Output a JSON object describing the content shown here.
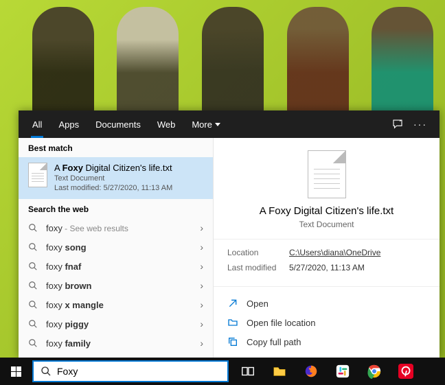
{
  "tabs": {
    "all": "All",
    "apps": "Apps",
    "documents": "Documents",
    "web": "Web",
    "more": "More"
  },
  "sections": {
    "best_match": "Best match",
    "search_web": "Search the web"
  },
  "best_match": {
    "title_prefix": "A ",
    "title_bold": "Foxy",
    "title_suffix": " Digital Citizen's life.txt",
    "type": "Text Document",
    "modified": "Last modified: 5/27/2020, 11:13 AM"
  },
  "web_results": [
    {
      "prefix": "foxy",
      "bold": "",
      "hint": " - See web results"
    },
    {
      "prefix": "foxy ",
      "bold": "song",
      "hint": ""
    },
    {
      "prefix": "foxy ",
      "bold": "fnaf",
      "hint": ""
    },
    {
      "prefix": "foxy ",
      "bold": "brown",
      "hint": ""
    },
    {
      "prefix": "foxy ",
      "bold": "x mangle",
      "hint": ""
    },
    {
      "prefix": "foxy ",
      "bold": "piggy",
      "hint": ""
    },
    {
      "prefix": "foxy ",
      "bold": "family",
      "hint": ""
    }
  ],
  "preview": {
    "title": "A Foxy Digital Citizen's life.txt",
    "type": "Text Document",
    "location_label": "Location",
    "location_value": "C:\\Users\\diana\\OneDrive",
    "modified_label": "Last modified",
    "modified_value": "5/27/2020, 11:13 AM"
  },
  "actions": {
    "open": "Open",
    "open_location": "Open file location",
    "copy_path": "Copy full path"
  },
  "searchbox": {
    "value": "Foxy"
  }
}
